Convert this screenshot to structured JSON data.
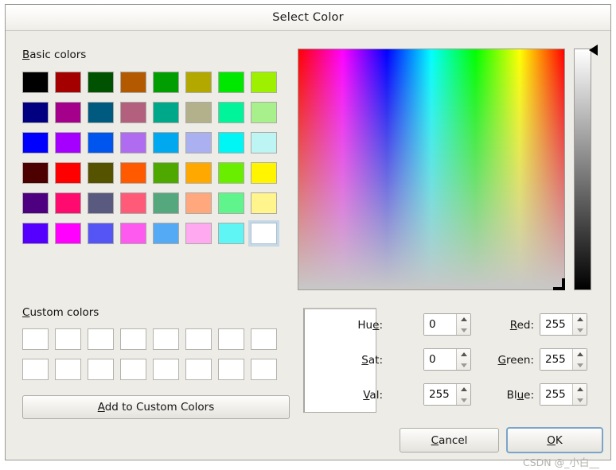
{
  "window": {
    "title": "Select Color"
  },
  "sections": {
    "basic_colors_label": "Basic colors",
    "basic_colors_accel": "B",
    "custom_colors_label": "Custom colors",
    "custom_colors_accel": "C"
  },
  "basic_colors": {
    "rows": [
      [
        "#000000",
        "#a50000",
        "#005200",
        "#b35a00",
        "#009e00",
        "#b3a800",
        "#00e800",
        "#9cf000"
      ],
      [
        "#000080",
        "#a5008c",
        "#005a80",
        "#b3607e",
        "#00a88a",
        "#b3b08c",
        "#00f59b",
        "#a8f08c"
      ],
      [
        "#0000ff",
        "#a500ff",
        "#0055ee",
        "#b06cf0",
        "#00a8f0",
        "#aab0f0",
        "#00f5f5",
        "#bdf5f5"
      ],
      [
        "#4d0000",
        "#ff0000",
        "#555200",
        "#ff5a00",
        "#4fa800",
        "#ffa800",
        "#6aee00",
        "#fff500"
      ],
      [
        "#4d0080",
        "#ff0a6e",
        "#5a5a80",
        "#ff5a78",
        "#55a87e",
        "#ffa87e",
        "#5ff58c",
        "#fff58c"
      ],
      [
        "#5500ff",
        "#ff00ff",
        "#5555f5",
        "#ff5af0",
        "#55aaf5",
        "#ffaaf0",
        "#5ff5f5",
        "#ffffff"
      ]
    ],
    "selected_index": 47
  },
  "custom_colors": {
    "count": 16,
    "empty_color": "#ffffff"
  },
  "buttons": {
    "add_custom": "Add to Custom Colors",
    "add_custom_accel": "A",
    "cancel": "Cancel",
    "cancel_accel": "C",
    "ok": "OK",
    "ok_accel": "O"
  },
  "fields": {
    "hue": {
      "label": "Hue",
      "accel": "e",
      "value": "0"
    },
    "sat": {
      "label": "Sat",
      "accel": "S",
      "value": "0"
    },
    "val": {
      "label": "Val",
      "accel": "V",
      "value": "255"
    },
    "red": {
      "label": "Red",
      "accel": "R",
      "value": "255"
    },
    "green": {
      "label": "Green",
      "accel": "G",
      "value": "255"
    },
    "blue": {
      "label": "Blue",
      "accel": "u",
      "value": "255"
    }
  },
  "preview": {
    "color": "#ffffff"
  },
  "value_slider": {
    "position_percent": 0,
    "top_color": "#ffffff",
    "bottom_color": "#000000"
  },
  "watermark": {
    "text": "CSDN @_小白__"
  }
}
